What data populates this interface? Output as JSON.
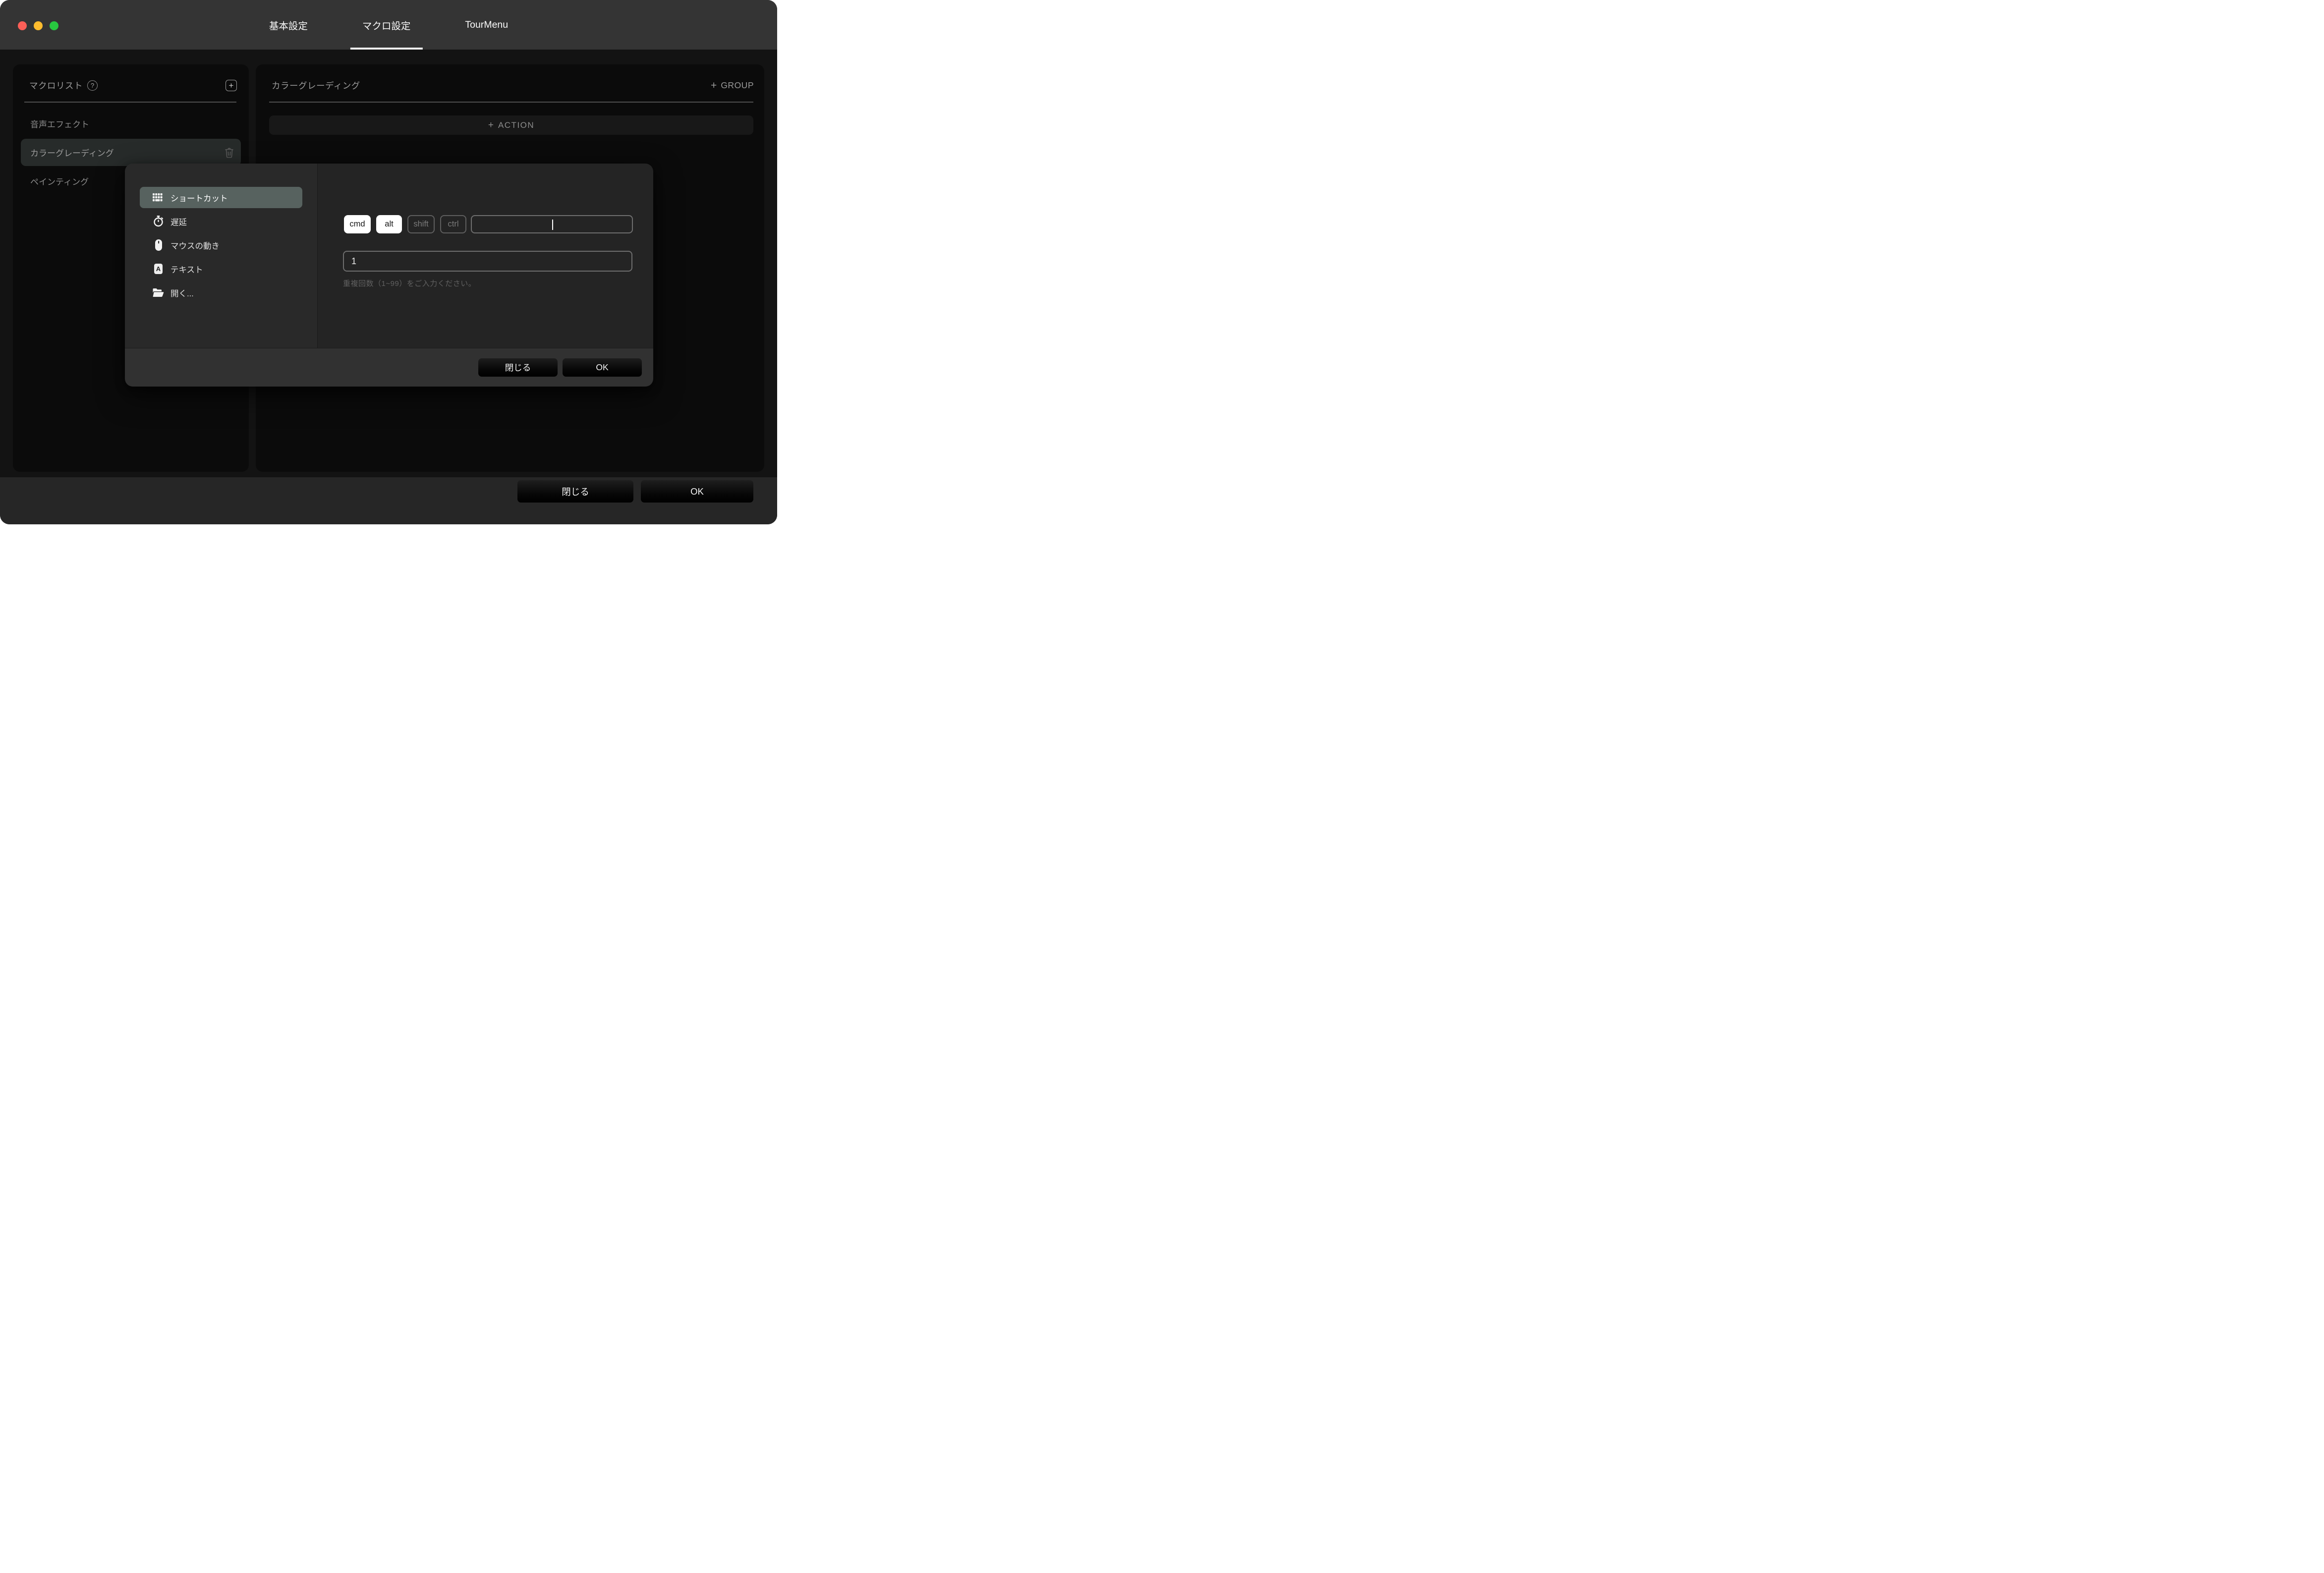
{
  "titlebar": {
    "tabs": [
      {
        "label": "基本設定",
        "active": false
      },
      {
        "label": "マクロ設定",
        "active": true
      },
      {
        "label": "TourMenu",
        "active": false
      }
    ]
  },
  "icons": {
    "help": "?",
    "plus": "+",
    "text_badge": "A"
  },
  "macro_list": {
    "title": "マクロリスト",
    "items": [
      {
        "label": "音声エフェクト",
        "selected": false
      },
      {
        "label": "カラーグレーディング",
        "selected": true
      },
      {
        "label": "ペインティング",
        "selected": false
      }
    ]
  },
  "detail": {
    "title": "カラーグレーディング",
    "group_label": "GROUP",
    "action_label": "ACTION"
  },
  "dialog": {
    "menu": [
      {
        "label": "ショートカット",
        "icon": "keyboard-icon",
        "selected": true
      },
      {
        "label": "遅延",
        "icon": "stopwatch-icon",
        "selected": false
      },
      {
        "label": "マウスの動き",
        "icon": "mouse-icon",
        "selected": false
      },
      {
        "label": "テキスト",
        "icon": "text-icon",
        "selected": false
      },
      {
        "label": "開く...",
        "icon": "folder-icon",
        "selected": false
      }
    ],
    "modifiers": [
      {
        "label": "cmd",
        "active": true
      },
      {
        "label": "alt",
        "active": true
      },
      {
        "label": "shift",
        "active": false
      },
      {
        "label": "ctrl",
        "active": false
      }
    ],
    "key_capture_value": "",
    "repeat_value": "1",
    "repeat_hint": "重複回数（1~99）をご入力ください。",
    "close_label": "閉じる",
    "ok_label": "OK"
  },
  "footer": {
    "close_label": "閉じる",
    "ok_label": "OK"
  },
  "colors": {
    "titlebar": "#343434",
    "panel": "#0b0b0b",
    "selected_menu": "#57625f",
    "traffic_red": "#fc5f57",
    "traffic_yellow": "#febc2e",
    "traffic_green": "#28c840"
  }
}
